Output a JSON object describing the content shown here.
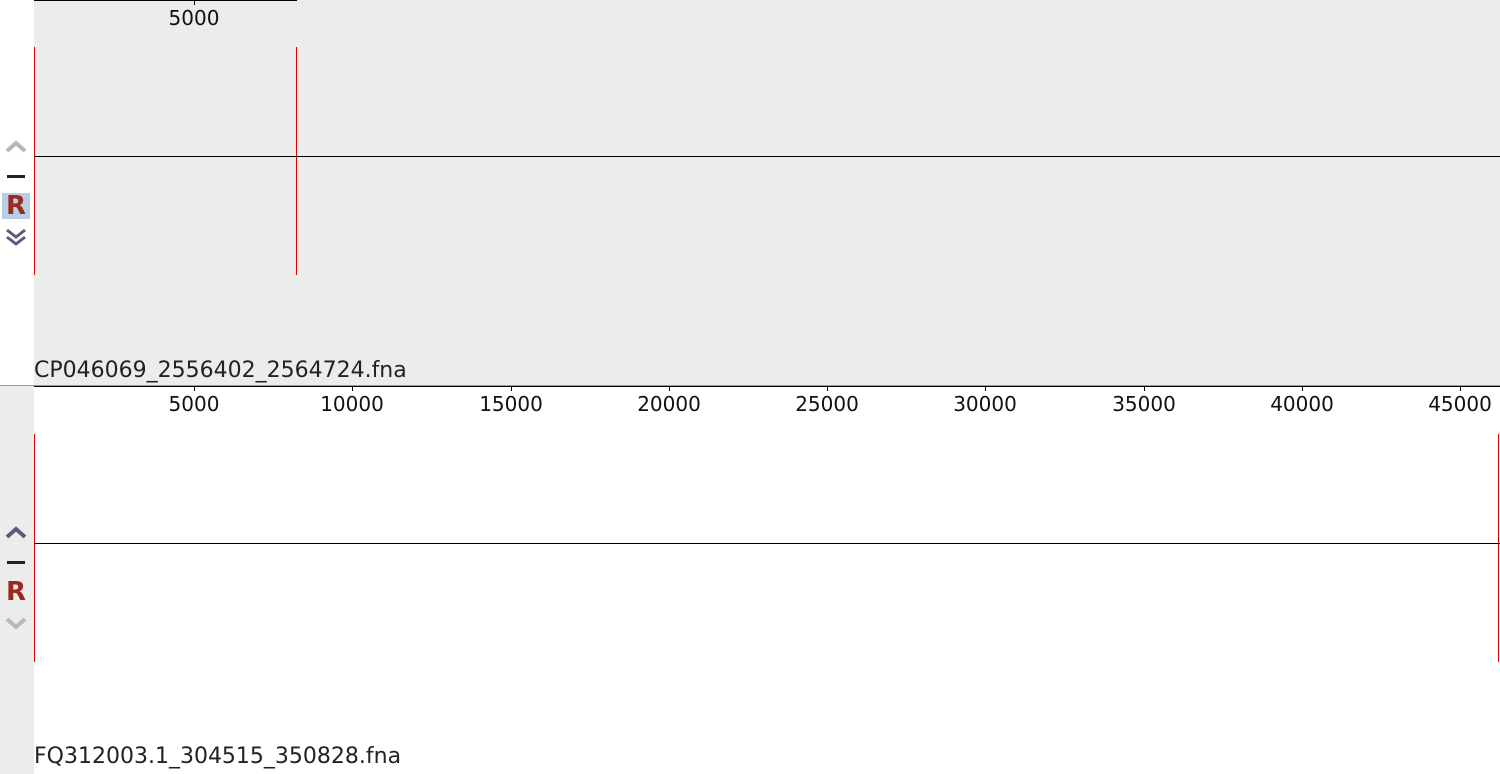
{
  "panels": [
    {
      "sequence_name": "CP046069_2556402_2564724.fna",
      "ruler_ticks": [
        "5000"
      ],
      "background": "#ececec",
      "gutter_background": "#ffffff",
      "reverse_selected": true,
      "up_enabled": false,
      "down_enabled": true
    },
    {
      "sequence_name": "FQ312003.1_304515_350828.fna",
      "ruler_ticks": [
        "5000",
        "10000",
        "15000",
        "20000",
        "25000",
        "30000",
        "35000",
        "40000",
        "45000"
      ],
      "background": "#ffffff",
      "gutter_background": "#ececec",
      "reverse_selected": false,
      "up_enabled": true,
      "down_enabled": false
    }
  ],
  "controls": {
    "reverse_label": "R"
  },
  "colors": {
    "boundary": "#e00000",
    "reverse_text": "#9a2a1e",
    "arrow_enabled": "#5c5c7a",
    "arrow_disabled": "#b8b8b8"
  }
}
